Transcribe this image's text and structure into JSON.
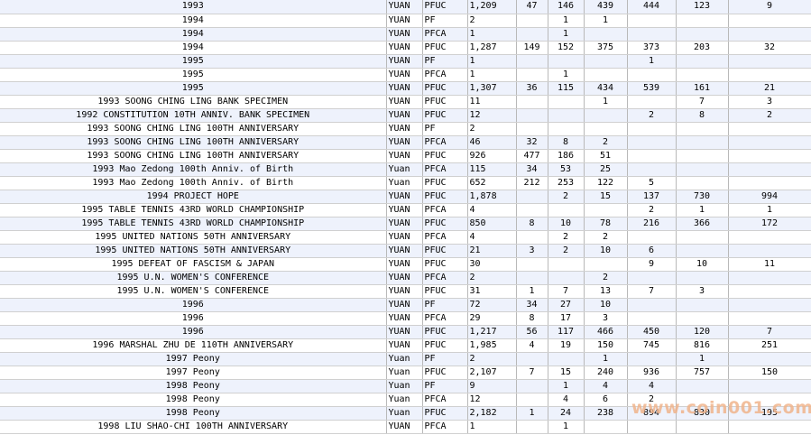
{
  "watermark": "www.coin001.com",
  "rows": [
    {
      "desc": "1993",
      "currency": "YUAN",
      "type": "PFUC",
      "total": "1,209",
      "c1": "47",
      "c2": "146",
      "c3": "439",
      "c4": "444",
      "c5": "123",
      "c6": "9"
    },
    {
      "desc": "1994",
      "currency": "YUAN",
      "type": "PF",
      "total": "2",
      "c1": "",
      "c2": "1",
      "c3": "1",
      "c4": "",
      "c5": "",
      "c6": ""
    },
    {
      "desc": "1994",
      "currency": "YUAN",
      "type": "PFCA",
      "total": "1",
      "c1": "",
      "c2": "1",
      "c3": "",
      "c4": "",
      "c5": "",
      "c6": ""
    },
    {
      "desc": "1994",
      "currency": "YUAN",
      "type": "PFUC",
      "total": "1,287",
      "c1": "149",
      "c2": "152",
      "c3": "375",
      "c4": "373",
      "c5": "203",
      "c6": "32"
    },
    {
      "desc": "1995",
      "currency": "YUAN",
      "type": "PF",
      "total": "1",
      "c1": "",
      "c2": "",
      "c3": "",
      "c4": "1",
      "c5": "",
      "c6": ""
    },
    {
      "desc": "1995",
      "currency": "YUAN",
      "type": "PFCA",
      "total": "1",
      "c1": "",
      "c2": "1",
      "c3": "",
      "c4": "",
      "c5": "",
      "c6": ""
    },
    {
      "desc": "1995",
      "currency": "YUAN",
      "type": "PFUC",
      "total": "1,307",
      "c1": "36",
      "c2": "115",
      "c3": "434",
      "c4": "539",
      "c5": "161",
      "c6": "21"
    },
    {
      "desc": "1993 SOONG CHING LING BANK SPECIMEN",
      "currency": "YUAN",
      "type": "PFUC",
      "total": "11",
      "c1": "",
      "c2": "",
      "c3": "1",
      "c4": "",
      "c5": "7",
      "c6": "3"
    },
    {
      "desc": "1992 CONSTITUTION 10TH ANNIV. BANK SPECIMEN",
      "currency": "YUAN",
      "type": "PFUC",
      "total": "12",
      "c1": "",
      "c2": "",
      "c3": "",
      "c4": "2",
      "c5": "8",
      "c6": "2"
    },
    {
      "desc": "1993 SOONG CHING LING 100TH ANNIVERSARY",
      "currency": "YUAN",
      "type": "PF",
      "total": "2",
      "c1": "",
      "c2": "",
      "c3": "",
      "c4": "",
      "c5": "",
      "c6": ""
    },
    {
      "desc": "1993 SOONG CHING LING 100TH ANNIVERSARY",
      "currency": "YUAN",
      "type": "PFCA",
      "total": "46",
      "c1": "32",
      "c2": "8",
      "c3": "2",
      "c4": "",
      "c5": "",
      "c6": ""
    },
    {
      "desc": "1993 SOONG CHING LING 100TH ANNIVERSARY",
      "currency": "YUAN",
      "type": "PFUC",
      "total": "926",
      "c1": "477",
      "c2": "186",
      "c3": "51",
      "c4": "",
      "c5": "",
      "c6": ""
    },
    {
      "desc": "1993 Mao Zedong 100th Anniv. of Birth",
      "currency": "Yuan",
      "type": "PFCA",
      "total": "115",
      "c1": "34",
      "c2": "53",
      "c3": "25",
      "c4": "",
      "c5": "",
      "c6": ""
    },
    {
      "desc": "1993 Mao Zedong 100th Anniv. of Birth",
      "currency": "Yuan",
      "type": "PFUC",
      "total": "652",
      "c1": "212",
      "c2": "253",
      "c3": "122",
      "c4": "5",
      "c5": "",
      "c6": ""
    },
    {
      "desc": "1994 PROJECT HOPE",
      "currency": "YUAN",
      "type": "PFUC",
      "total": "1,878",
      "c1": "",
      "c2": "2",
      "c3": "15",
      "c4": "137",
      "c5": "730",
      "c6": "994"
    },
    {
      "desc": "1995 TABLE TENNIS 43RD WORLD CHAMPIONSHIP",
      "currency": "YUAN",
      "type": "PFCA",
      "total": "4",
      "c1": "",
      "c2": "",
      "c3": "",
      "c4": "2",
      "c5": "1",
      "c6": "1"
    },
    {
      "desc": "1995 TABLE TENNIS 43RD WORLD CHAMPIONSHIP",
      "currency": "YUAN",
      "type": "PFUC",
      "total": "850",
      "c1": "8",
      "c2": "10",
      "c3": "78",
      "c4": "216",
      "c5": "366",
      "c6": "172"
    },
    {
      "desc": "1995 UNITED NATIONS 50TH ANNIVERSARY",
      "currency": "YUAN",
      "type": "PFCA",
      "total": "4",
      "c1": "",
      "c2": "2",
      "c3": "2",
      "c4": "",
      "c5": "",
      "c6": ""
    },
    {
      "desc": "1995 UNITED NATIONS 50TH ANNIVERSARY",
      "currency": "YUAN",
      "type": "PFUC",
      "total": "21",
      "c1": "3",
      "c2": "2",
      "c3": "10",
      "c4": "6",
      "c5": "",
      "c6": ""
    },
    {
      "desc": "1995 DEFEAT OF FASCISM & JAPAN",
      "currency": "YUAN",
      "type": "PFUC",
      "total": "30",
      "c1": "",
      "c2": "",
      "c3": "",
      "c4": "9",
      "c5": "10",
      "c6": "11"
    },
    {
      "desc": "1995 U.N. WOMEN'S CONFERENCE",
      "currency": "YUAN",
      "type": "PFCA",
      "total": "2",
      "c1": "",
      "c2": "",
      "c3": "2",
      "c4": "",
      "c5": "",
      "c6": ""
    },
    {
      "desc": "1995 U.N. WOMEN'S CONFERENCE",
      "currency": "YUAN",
      "type": "PFUC",
      "total": "31",
      "c1": "1",
      "c2": "7",
      "c3": "13",
      "c4": "7",
      "c5": "3",
      "c6": ""
    },
    {
      "desc": "1996",
      "currency": "YUAN",
      "type": "PF",
      "total": "72",
      "c1": "34",
      "c2": "27",
      "c3": "10",
      "c4": "",
      "c5": "",
      "c6": ""
    },
    {
      "desc": "1996",
      "currency": "YUAN",
      "type": "PFCA",
      "total": "29",
      "c1": "8",
      "c2": "17",
      "c3": "3",
      "c4": "",
      "c5": "",
      "c6": ""
    },
    {
      "desc": "1996",
      "currency": "YUAN",
      "type": "PFUC",
      "total": "1,217",
      "c1": "56",
      "c2": "117",
      "c3": "466",
      "c4": "450",
      "c5": "120",
      "c6": "7"
    },
    {
      "desc": "1996 MARSHAL ZHU DE 110TH ANNIVERSARY",
      "currency": "YUAN",
      "type": "PFUC",
      "total": "1,985",
      "c1": "4",
      "c2": "19",
      "c3": "150",
      "c4": "745",
      "c5": "816",
      "c6": "251"
    },
    {
      "desc": "1997 Peony",
      "currency": "Yuan",
      "type": "PF",
      "total": "2",
      "c1": "",
      "c2": "",
      "c3": "1",
      "c4": "",
      "c5": "1",
      "c6": ""
    },
    {
      "desc": "1997 Peony",
      "currency": "Yuan",
      "type": "PFUC",
      "total": "2,107",
      "c1": "7",
      "c2": "15",
      "c3": "240",
      "c4": "936",
      "c5": "757",
      "c6": "150"
    },
    {
      "desc": "1998 Peony",
      "currency": "Yuan",
      "type": "PF",
      "total": "9",
      "c1": "",
      "c2": "1",
      "c3": "4",
      "c4": "4",
      "c5": "",
      "c6": ""
    },
    {
      "desc": "1998 Peony",
      "currency": "Yuan",
      "type": "PFCA",
      "total": "12",
      "c1": "",
      "c2": "4",
      "c3": "6",
      "c4": "2",
      "c5": "",
      "c6": ""
    },
    {
      "desc": "1998 Peony",
      "currency": "Yuan",
      "type": "PFUC",
      "total": "2,182",
      "c1": "1",
      "c2": "24",
      "c3": "238",
      "c4": "894",
      "c5": "830",
      "c6": "195"
    },
    {
      "desc": "1998 LIU SHAO-CHI 100TH ANNIVERSARY",
      "currency": "YUAN",
      "type": "PFCA",
      "total": "1",
      "c1": "",
      "c2": "1",
      "c3": "",
      "c4": "",
      "c5": "",
      "c6": ""
    }
  ]
}
